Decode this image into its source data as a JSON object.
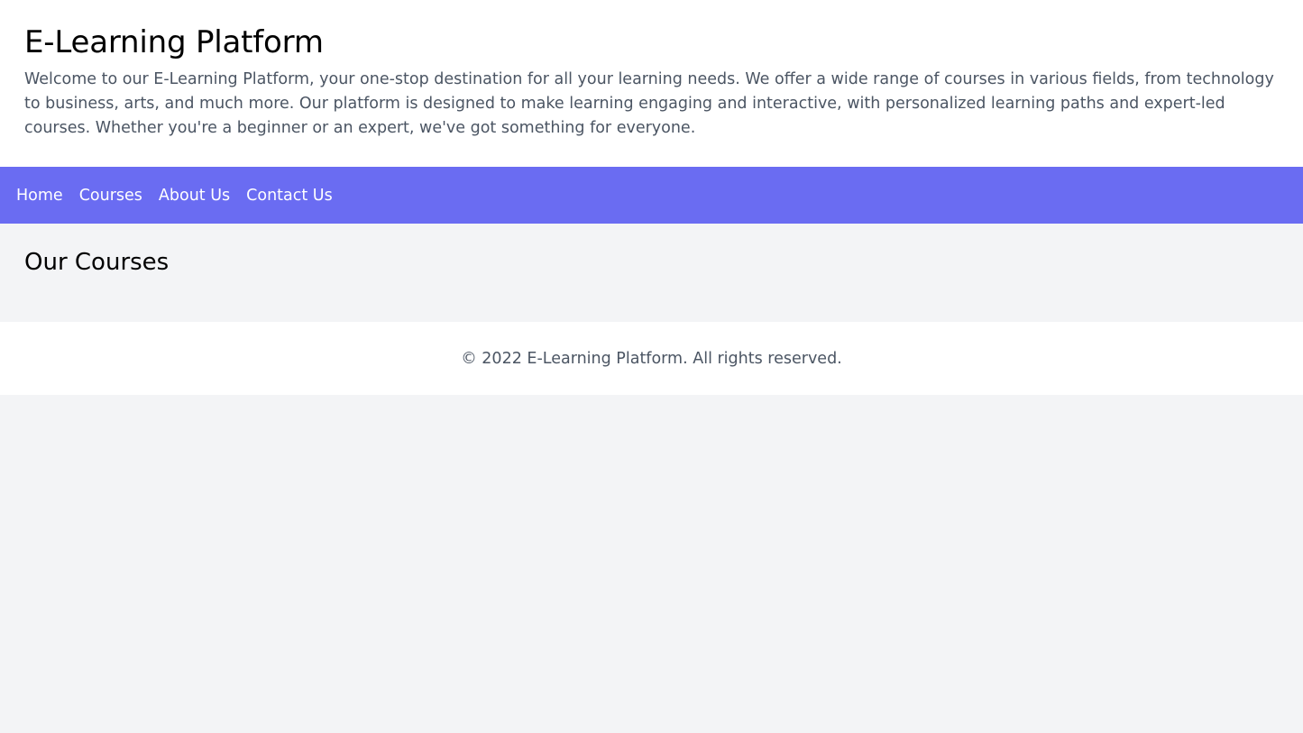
{
  "header": {
    "title": "E-Learning Platform",
    "intro": "Welcome to our E-Learning Platform, your one-stop destination for all your learning needs. We offer a wide range of courses in various fields, from technology to business, arts, and much more. Our platform is designed to make learning engaging and interactive, with personalized learning paths and expert-led courses. Whether you're a beginner or an expert, we've got something for everyone."
  },
  "nav": {
    "items": [
      {
        "label": "Home"
      },
      {
        "label": "Courses"
      },
      {
        "label": "About Us"
      },
      {
        "label": "Contact Us"
      }
    ]
  },
  "main": {
    "heading": "Our Courses"
  },
  "footer": {
    "copyright": "© 2022 E-Learning Platform. All rights reserved."
  },
  "colors": {
    "nav_background": "#6a6cf2",
    "page_background": "#f3f4f6",
    "body_text": "#4b5563"
  }
}
